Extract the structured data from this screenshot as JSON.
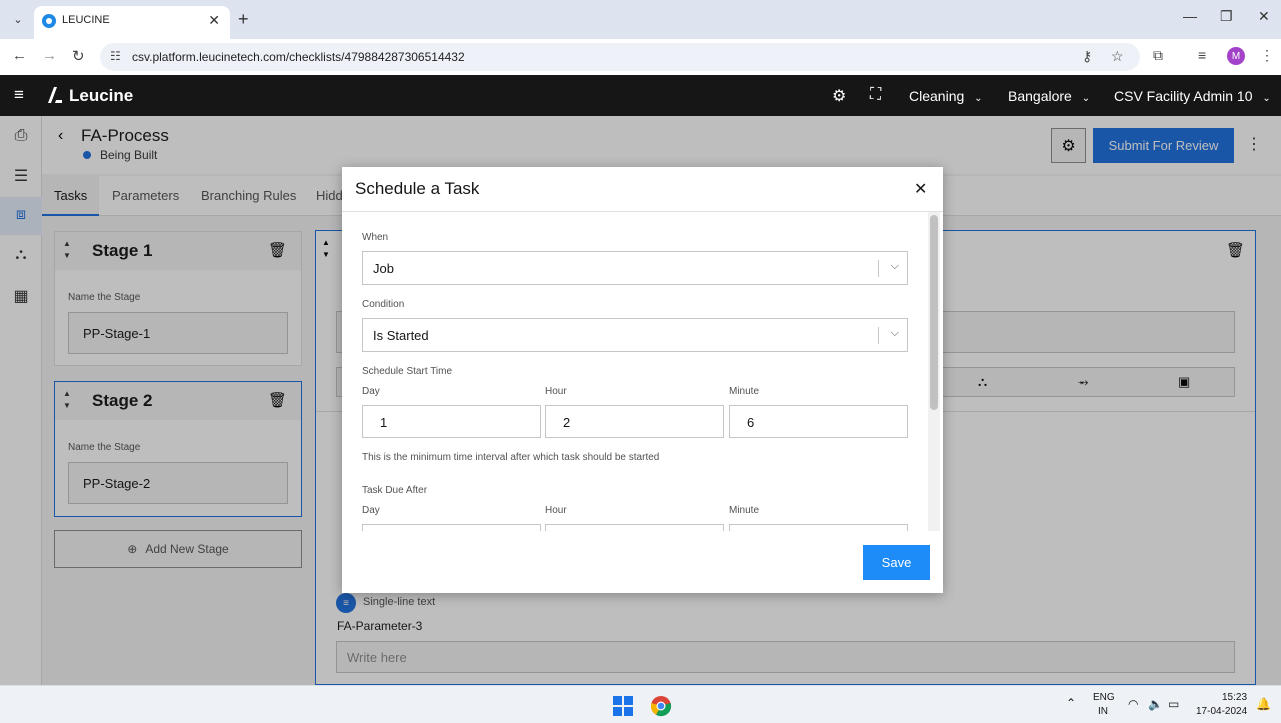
{
  "browser": {
    "tab_title": "LEUCINE",
    "url": "csv.platform.leucinetech.com/checklists/479884287306514432",
    "profile_initial": "M"
  },
  "app": {
    "brand": "Leucine",
    "facility_selector": "Cleaning",
    "site_selector": "Bangalore",
    "user_selector": "CSV Facility Admin 10"
  },
  "process": {
    "title": "FA-Process",
    "status": "Being Built",
    "submit_label": "Submit For Review"
  },
  "tabs": [
    "Tasks",
    "Parameters",
    "Branching Rules",
    "Hidd"
  ],
  "stages": [
    {
      "title": "Stage 1",
      "label": "Name the Stage",
      "value": "PP-Stage-1"
    },
    {
      "title": "Stage 2",
      "label": "Name the Stage",
      "value": "PP-Stage-2"
    }
  ],
  "add_stage_label": "Add New Stage",
  "parameter": {
    "type": "Single-line text",
    "name": "FA-Parameter-3",
    "placeholder": "Write here"
  },
  "modal": {
    "title": "Schedule a Task",
    "when_label": "When",
    "when_value": "Job",
    "condition_label": "Condition",
    "condition_value": "Is Started",
    "start_section": "Schedule Start Time",
    "day_label": "Day",
    "hour_label": "Hour",
    "minute_label": "Minute",
    "day_value": "1",
    "hour_value": "2",
    "minute_value": "6",
    "help_text": "This is the minimum time interval after which task should be started",
    "due_section": "Task Due After",
    "save_label": "Save"
  },
  "taskbar": {
    "lang_1": "ENG",
    "lang_2": "IN",
    "time": "15:23",
    "date": "17-04-2024"
  },
  "colors": {
    "primary": "#1d6fe0",
    "save": "#1d8cf8",
    "header_bg": "#161616"
  }
}
